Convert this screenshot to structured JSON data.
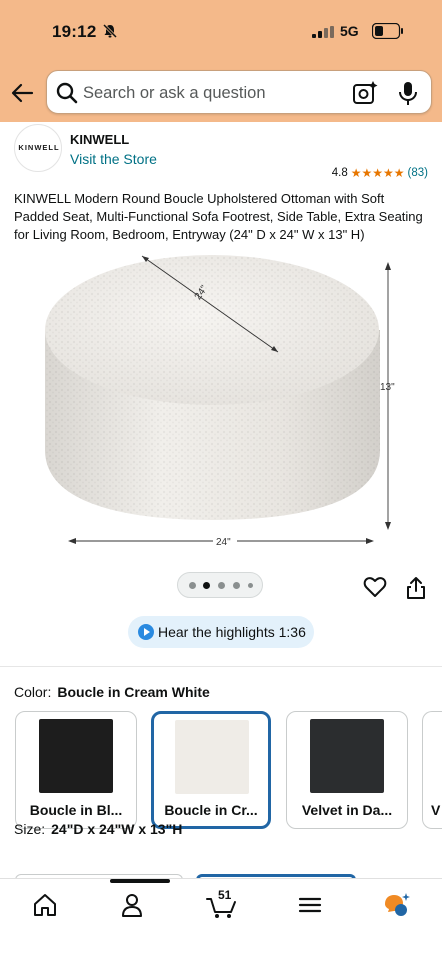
{
  "status_bar": {
    "time": "19:12",
    "network": "5G"
  },
  "search": {
    "placeholder": "Search or ask a question"
  },
  "store": {
    "logo_text": "KINWELL",
    "brand": "KINWELL",
    "visit_link": "Visit the Store"
  },
  "rating": {
    "score": "4.8",
    "stars": "★★★★★",
    "count": "(83)"
  },
  "product": {
    "title": "KINWELL Modern Round Boucle Upholstered Ottoman with Soft Padded Seat, Multi-Functional Sofa Footrest, Side Table, Extra Seating for Living Room, Bedroom, Entryway (24\" D x 24\" W x 13\" H)",
    "dim_diameter": "24\"",
    "dim_width": "24\"",
    "dim_height": "13\""
  },
  "carousel": {
    "dot_count": 5,
    "active_index": 1
  },
  "highlights": {
    "label": "Hear the highlights 1:36"
  },
  "color": {
    "label": "Color:",
    "selected": "Boucle in Cream White",
    "options": [
      {
        "label": "Boucle in Bl...",
        "swatch": "#1d1d1d"
      },
      {
        "label": "Boucle in Cr...",
        "swatch": "#efece7"
      },
      {
        "label": "Velvet in Da...",
        "swatch": "#2b2d2f"
      },
      {
        "label": "V",
        "swatch": "#cccccc"
      }
    ]
  },
  "size": {
    "label": "Size:",
    "selected": "24\"D x 24\"W x 13\"H"
  },
  "nav": {
    "cart_count": "51"
  },
  "colors": {
    "header": "#f4b98a",
    "link": "#007185",
    "star": "#e77600",
    "selected_border": "#2166a5",
    "highlight_bg": "#e3f1fb"
  }
}
